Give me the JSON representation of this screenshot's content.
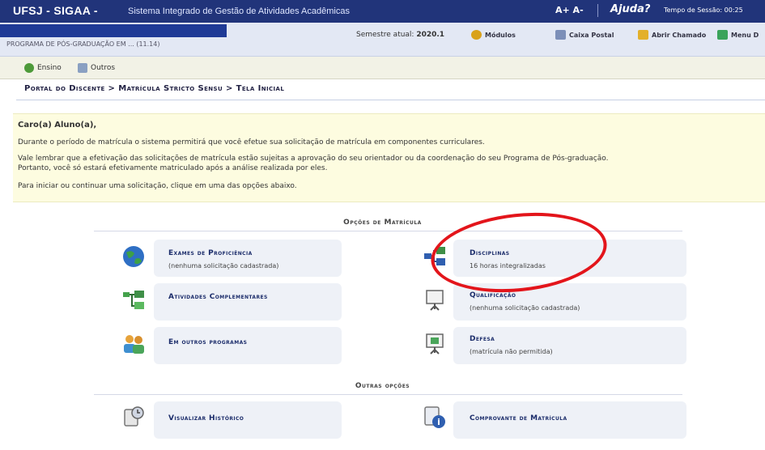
{
  "header": {
    "title": "UFSJ - SIGAA -",
    "subtitle": "Sistema Integrado de Gestão de Atividades Acadêmicas",
    "font_control": "A+ A-",
    "help": "Ajuda?",
    "session": "Tempo de Sessão: 00:25"
  },
  "infobar": {
    "unit": "PROGRAMA DE PÓS-GRADUAÇÃO EM ... (11.14)",
    "semester_label": "Semestre atual:",
    "semester_value": "2020.1",
    "buttons": [
      {
        "label": "Módulos",
        "icon": "modules-icon"
      },
      {
        "label": "Caixa Postal",
        "icon": "mailbox-icon"
      },
      {
        "label": "Abrir Chamado",
        "icon": "ticket-icon"
      },
      {
        "label": "Menu D",
        "icon": "menu-icon"
      }
    ]
  },
  "modules": [
    {
      "label": "Ensino",
      "icon": "teaching-icon"
    },
    {
      "label": "Outros",
      "icon": "others-icon"
    }
  ],
  "breadcrumb": "Portal do Discente > Matrícula Stricto Sensu > Tela Inicial",
  "notice": {
    "greeting": "Caro(a) Aluno(a),",
    "line1": "Durante o período de matrícula o sistema permitirá que você efetue sua solicitação de matrícula em componentes curriculares.",
    "line2": "Vale lembrar que a efetivação das solicitações de matrícula estão sujeitas a aprovação do seu orientador ou da coordenação do seu Programa de Pós-graduação.",
    "line3": "Portanto, você só estará efetivamente matriculado após a análise realizada por eles.",
    "line4": "Para iniciar ou continuar uma solicitação, clique em uma das opções abaixo."
  },
  "matricula_options": {
    "title": "Opções de Matrícula",
    "items": [
      {
        "label": "Exames de Proficiência",
        "sub": "(nenhuma solicitação cadastrada)",
        "icon": "globe-icon"
      },
      {
        "label": "Disciplinas",
        "sub": "16 horas integralizadas",
        "icon": "disciplines-icon"
      },
      {
        "label": "Atividades Complementares",
        "sub": "",
        "icon": "activities-icon"
      },
      {
        "label": "Qualificação",
        "sub": "(nenhuma solicitação cadastrada)",
        "icon": "presentation-icon"
      },
      {
        "label": "Em outros programas",
        "sub": "",
        "icon": "people-icon"
      },
      {
        "label": "Defesa",
        "sub": "(matrícula não permitida)",
        "icon": "defense-icon"
      }
    ]
  },
  "other_options": {
    "title": "Outras opções",
    "items": [
      {
        "label": "Visualizar Histórico",
        "icon": "history-icon"
      },
      {
        "label": "Comprovante de Matrícula",
        "icon": "receipt-icon"
      }
    ]
  },
  "colors": {
    "topbar": "#21347a",
    "infobar": "#e3e8f4",
    "notice_bg": "#fdfce0",
    "card_bg": "#eef1f7",
    "link": "#1c2d6b",
    "highlight": "#e3151b"
  }
}
